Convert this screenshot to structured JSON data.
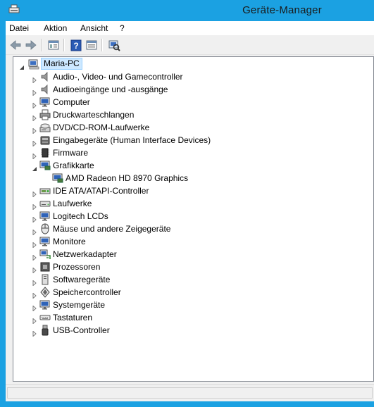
{
  "window": {
    "title": "Geräte-Manager"
  },
  "menubar": [
    {
      "label": "Datei",
      "name": "menu-datei"
    },
    {
      "label": "Aktion",
      "name": "menu-aktion"
    },
    {
      "label": "Ansicht",
      "name": "menu-ansicht"
    },
    {
      "label": "?",
      "name": "menu-help"
    }
  ],
  "toolbar": [
    {
      "icon": "back-arrow-icon"
    },
    {
      "icon": "forward-arrow-icon"
    },
    {
      "icon": "properties-view-icon"
    },
    {
      "icon": "help-icon"
    },
    {
      "icon": "details-view-icon"
    },
    {
      "icon": "scan-hardware-icon"
    }
  ],
  "tree": {
    "root": {
      "label": "Maria-PC",
      "icon": "computer-icon"
    },
    "nodes": [
      {
        "label": "Audio-, Video- und Gamecontroller",
        "icon": "speaker-icon",
        "expanded": false,
        "level": 1
      },
      {
        "label": "Audioeingänge und -ausgänge",
        "icon": "speaker-icon",
        "expanded": false,
        "level": 1
      },
      {
        "label": "Computer",
        "icon": "monitor-icon",
        "expanded": false,
        "level": 1
      },
      {
        "label": "Druckwarteschlangen",
        "icon": "printer-icon",
        "expanded": false,
        "level": 1
      },
      {
        "label": "DVD/CD-ROM-Laufwerke",
        "icon": "disc-drive-icon",
        "expanded": false,
        "level": 1
      },
      {
        "label": "Eingabegeräte (Human Interface Devices)",
        "icon": "hid-icon",
        "expanded": false,
        "level": 1
      },
      {
        "label": "Firmware",
        "icon": "chip-icon",
        "expanded": false,
        "level": 1
      },
      {
        "label": "Grafikkarte",
        "icon": "display-adapter-icon",
        "expanded": true,
        "level": 1
      },
      {
        "label": "AMD Radeon HD 8970 Graphics",
        "icon": "display-adapter-icon",
        "expanded": null,
        "level": 2
      },
      {
        "label": "IDE ATA/ATAPI-Controller",
        "icon": "ide-controller-icon",
        "expanded": false,
        "level": 1
      },
      {
        "label": "Laufwerke",
        "icon": "drive-icon",
        "expanded": false,
        "level": 1
      },
      {
        "label": "Logitech LCDs",
        "icon": "monitor-icon",
        "expanded": false,
        "level": 1
      },
      {
        "label": "Mäuse und andere Zeigegeräte",
        "icon": "mouse-icon",
        "expanded": false,
        "level": 1
      },
      {
        "label": "Monitore",
        "icon": "monitor-icon",
        "expanded": false,
        "level": 1
      },
      {
        "label": "Netzwerkadapter",
        "icon": "network-adapter-icon",
        "expanded": false,
        "level": 1
      },
      {
        "label": "Prozessoren",
        "icon": "processor-icon",
        "expanded": false,
        "level": 1
      },
      {
        "label": "Softwaregeräte",
        "icon": "software-device-icon",
        "expanded": false,
        "level": 1
      },
      {
        "label": "Speichercontroller",
        "icon": "storage-controller-icon",
        "expanded": false,
        "level": 1
      },
      {
        "label": "Systemgeräte",
        "icon": "monitor-icon",
        "expanded": false,
        "level": 1
      },
      {
        "label": "Tastaturen",
        "icon": "keyboard-icon",
        "expanded": false,
        "level": 1
      },
      {
        "label": "USB-Controller",
        "icon": "usb-icon",
        "expanded": false,
        "level": 1
      }
    ]
  },
  "colors": {
    "titlebar": "#1ba1e2",
    "selection": "#cde8ff",
    "selection_border": "#99d1ff"
  }
}
